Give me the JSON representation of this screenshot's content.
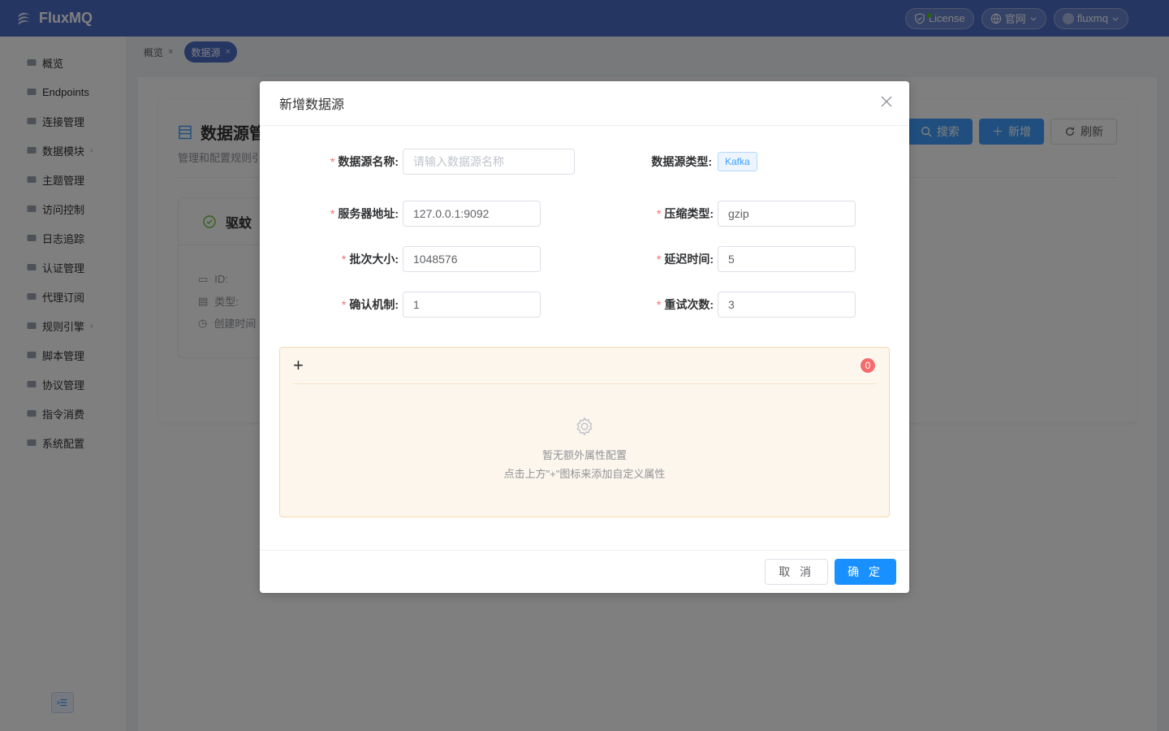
{
  "app": {
    "name": "FluxMQ"
  },
  "header": {
    "license_label": "License",
    "site_label": "官网",
    "user_label": "fluxmq"
  },
  "sidebar": {
    "items": [
      {
        "label": "概览",
        "icon": "dashboard-icon"
      },
      {
        "label": "Endpoints",
        "icon": "globe-icon"
      },
      {
        "label": "连接管理",
        "icon": "connection-icon"
      },
      {
        "label": "数据模块",
        "icon": "data-module-icon",
        "has_children": true
      },
      {
        "label": "主题管理",
        "icon": "hash-icon"
      },
      {
        "label": "访问控制",
        "icon": "key-icon"
      },
      {
        "label": "日志追踪",
        "icon": "log-search-icon"
      },
      {
        "label": "认证管理",
        "icon": "auth-icon"
      },
      {
        "label": "代理订阅",
        "icon": "subscribe-icon"
      },
      {
        "label": "规则引擎",
        "icon": "rules-icon",
        "has_children": true
      },
      {
        "label": "脚本管理",
        "icon": "script-icon"
      },
      {
        "label": "协议管理",
        "icon": "protocol-icon"
      },
      {
        "label": "指令消费",
        "icon": "command-icon"
      },
      {
        "label": "系统配置",
        "icon": "settings-icon"
      }
    ],
    "chevron": "›"
  },
  "tabs": [
    {
      "label": "概览",
      "active": false
    },
    {
      "label": "数据源",
      "active": true
    }
  ],
  "page": {
    "title": "数据源管",
    "subtitle": "管理和配置规则引",
    "actions": {
      "search": "搜索",
      "add": "新增",
      "refresh": "刷新"
    },
    "item": {
      "name": "驱蚊",
      "fields": {
        "id": "ID:",
        "type": "类型:",
        "created": "创建时间"
      }
    }
  },
  "dialog": {
    "title": "新增数据源",
    "fields": {
      "name": {
        "label": "数据源名称:",
        "placeholder": "请输入数据源名称",
        "value": ""
      },
      "type": {
        "label": "数据源类型:",
        "value": "Kafka"
      },
      "server": {
        "label": "服务器地址:",
        "value": "127.0.0.1:9092"
      },
      "compression": {
        "label": "压缩类型:",
        "value": "gzip"
      },
      "batch": {
        "label": "批次大小:",
        "value": "1048576"
      },
      "linger": {
        "label": "延迟时间:",
        "value": "5"
      },
      "acks": {
        "label": "确认机制:",
        "value": "1"
      },
      "retries": {
        "label": "重试次数:",
        "value": "3"
      }
    },
    "props": {
      "add_symbol": "+",
      "count": "0",
      "empty_title": "暂无额外属性配置",
      "empty_hint": "点击上方\"+\"图标来添加自定义属性"
    },
    "footer": {
      "cancel": "取 消",
      "confirm": "确 定"
    }
  },
  "colors": {
    "header_bg": "#4c6dc7",
    "primary": "#409eff",
    "confirm": "#1890ff",
    "danger": "#f56c6c",
    "props_bg": "#fdf6ec"
  }
}
